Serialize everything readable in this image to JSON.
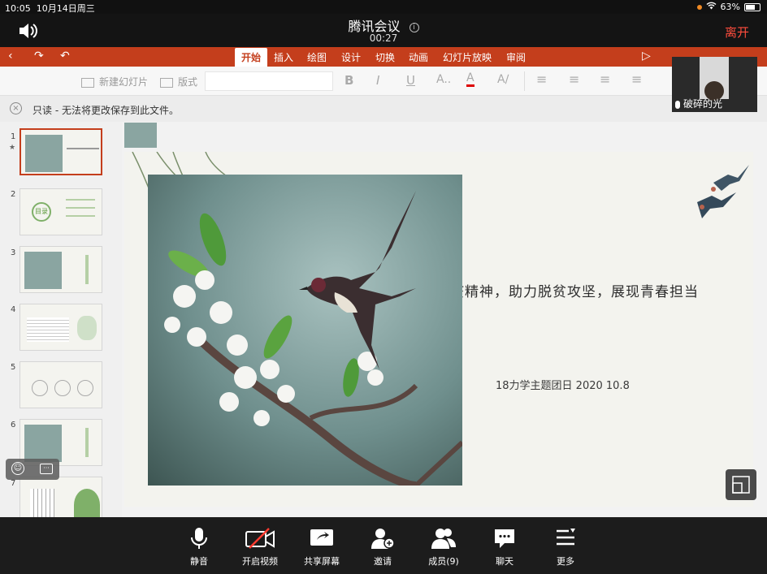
{
  "status": {
    "time": "10:05",
    "date": "10月14日周三",
    "battery": "63%"
  },
  "meeting": {
    "title": "腾讯会议",
    "timer": "00:27",
    "leave": "离开"
  },
  "ribbon": {
    "tabs": [
      "开始",
      "插入",
      "绘图",
      "设计",
      "切换",
      "动画",
      "幻灯片放映",
      "审阅"
    ],
    "active": "开始"
  },
  "toolbar": {
    "new_slide": "新建幻灯片",
    "layout": "版式"
  },
  "notice": "只读 - 无法将更改保存到此文件。",
  "thumbs": [
    {
      "num": "1"
    },
    {
      "num": "2",
      "label": "目录"
    },
    {
      "num": "3"
    },
    {
      "num": "4"
    },
    {
      "num": "5"
    },
    {
      "num": "6"
    },
    {
      "num": "7"
    }
  ],
  "slide": {
    "headline": "弘扬抗疫精神，助力脱贫攻坚，展现青春担当",
    "subline": "18力学主题团日 2020 10.8"
  },
  "participant": {
    "name": "破碎的光"
  },
  "bottom": {
    "mute": "静音",
    "video": "开启视频",
    "share": "共享屏幕",
    "invite": "邀请",
    "members": "成员(9)",
    "chat": "聊天",
    "more": "更多"
  }
}
